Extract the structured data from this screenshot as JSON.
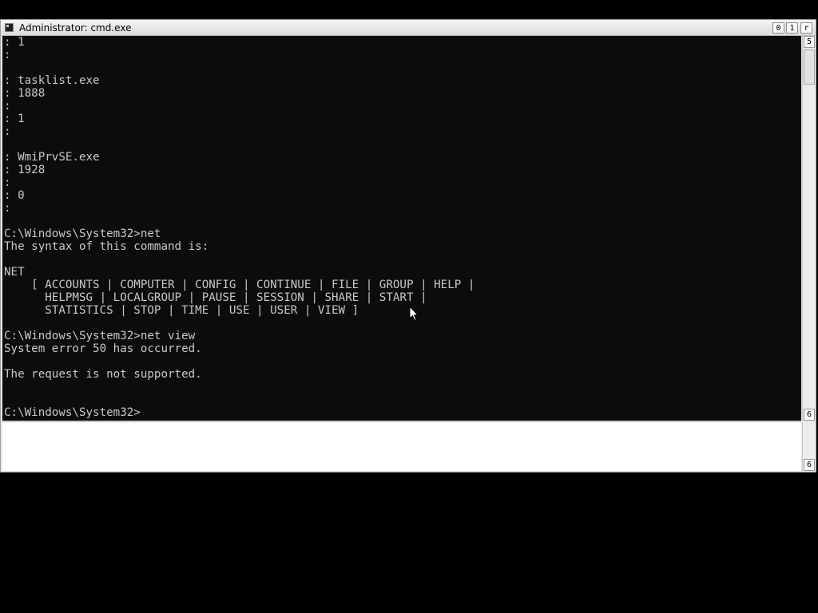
{
  "window": {
    "title": "Administrator: cmd.exe",
    "buttons": {
      "minimize": "0",
      "maximize": "1",
      "close": "r"
    }
  },
  "scrollbar": {
    "up_glyph": "5",
    "down_glyph": "6",
    "corner_down_glyph": "6"
  },
  "console": {
    "lines": [
      ": 1",
      ":",
      "",
      ": tasklist.exe",
      ": 1888",
      ":",
      ": 1",
      ":",
      "",
      ": WmiPrvSE.exe",
      ": 1928",
      ":",
      ": 0",
      ":",
      "",
      "C:\\Windows\\System32>net",
      "The syntax of this command is:",
      "",
      "NET",
      "    [ ACCOUNTS | COMPUTER | CONFIG | CONTINUE | FILE | GROUP | HELP |",
      "      HELPMSG | LOCALGROUP | PAUSE | SESSION | SHARE | START |",
      "      STATISTICS | STOP | TIME | USE | USER | VIEW ]",
      "",
      "C:\\Windows\\System32>net view",
      "System error 50 has occurred.",
      "",
      "The request is not supported.",
      "",
      "",
      "C:\\Windows\\System32>"
    ]
  },
  "colors": {
    "console_bg": "#0c0c0c",
    "console_fg": "#c8c8c8"
  }
}
